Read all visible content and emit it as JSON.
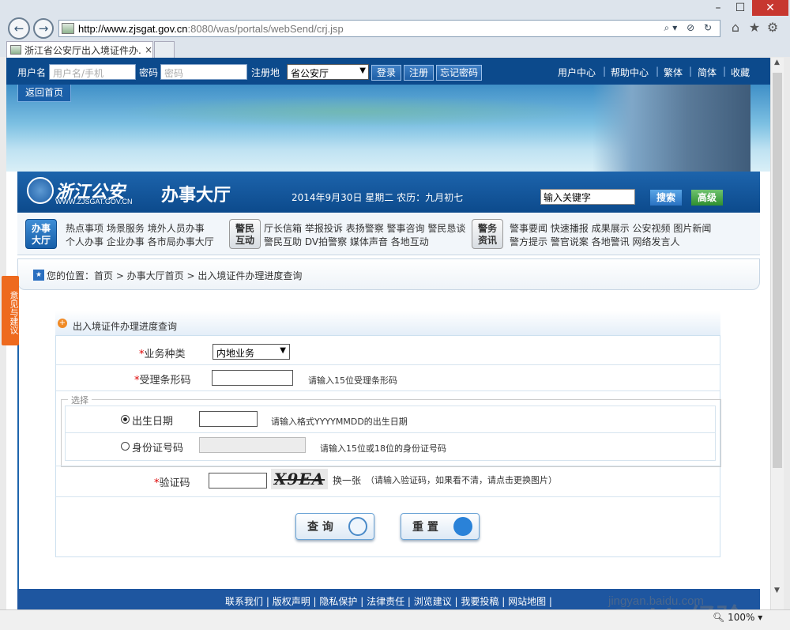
{
  "browser": {
    "url_host": "http://www.zjsgat.gov.cn",
    "url_rest": ":8080/was/portals/webSend/crj.jsp",
    "tab_title": "浙江省公安厅出入境证件办...",
    "tab_close": "×",
    "zoom": "100%",
    "window": {
      "min": "–",
      "max": "☐",
      "close": "✕"
    },
    "nav_back": "←",
    "nav_forward": "→",
    "addr_controls": "⌕▾ ⊘ ↻",
    "home_icon": "⌂",
    "star_icon": "★",
    "gear_icon": "⚙"
  },
  "topbar": {
    "username_label": "用户名",
    "username_placeholder": "用户名/手机",
    "password_label": "密码",
    "password_placeholder": "密码",
    "region_label": "注册地",
    "region_value": "省公安厅",
    "login": "登录",
    "register": "注册",
    "forgot": "忘记密码",
    "links": [
      "用户中心",
      "帮助中心",
      "繁体",
      "简体",
      "收藏"
    ]
  },
  "banner": {
    "back_home": "返回首页"
  },
  "hall": {
    "logo_text": "浙江公安",
    "logo_url": "WWW.ZJSGAT.GOV.CN",
    "title": "办事大厅",
    "date": "2014年9月30日  星期二  农历：九月初七",
    "keyword_value": "输入关键字",
    "search": "搜索",
    "advanced": "高级"
  },
  "menu": {
    "cat1": "办事\n大厅",
    "cat1_lines": [
      "办事",
      "大厅"
    ],
    "cat2_lines": [
      "警民",
      "互动"
    ],
    "cat3_lines": [
      "警务",
      "资讯"
    ],
    "group1_row1": [
      "热点事项",
      "场景服务",
      "境外人员办事"
    ],
    "group1_row2": [
      "个人办事",
      "企业办事",
      "各市局办事大厅"
    ],
    "group2_row1": [
      "厅长信箱",
      "举报投诉",
      "表扬警察",
      "警事咨询",
      "警民恳谈"
    ],
    "group2_row2": [
      "警民互助",
      "DV拍警察",
      "媒体声音",
      "各地互动"
    ],
    "group3_row1": [
      "警事要闻",
      "快速播报",
      "成果展示",
      "公安视频",
      "图片新闻"
    ],
    "group3_row2": [
      "警方提示",
      "警官说案",
      "各地警讯",
      "网络发言人"
    ]
  },
  "breadcrumb": {
    "text": "您的位置：首页 > 办事大厅首页 > 出入境证件办理进度查询"
  },
  "form": {
    "heading": "出入境证件办理进度查询",
    "biz_label": "业务种类",
    "biz_value": "内地业务",
    "barcode_label": "受理条形码",
    "barcode_hint": "请输入15位受理条形码",
    "fieldset_legend": "选择",
    "birth_label": "出生日期",
    "birth_hint": "请输入格式YYYYMMDD的出生日期",
    "id_label": "身份证号码",
    "id_hint": "请输入15位或18位的身份证号码",
    "captcha_label": "验证码",
    "captcha_image_text": "X9EA",
    "captcha_change": "换一张",
    "captcha_hint": "（请输入验证码，如果看不清，请点击更换图片）",
    "required_mark": "*",
    "query": "查 询",
    "reset": "重 置"
  },
  "footer": {
    "text": "联系我们  |  版权声明  |  隐私保护  |  法律责任  |  浏览建议  |  我要投稿  |  网站地图  |"
  },
  "feedback": {
    "text": "意见与建议"
  },
  "watermark": {
    "brand": "Baidu经验",
    "url": "jingyan.baidu.com"
  }
}
